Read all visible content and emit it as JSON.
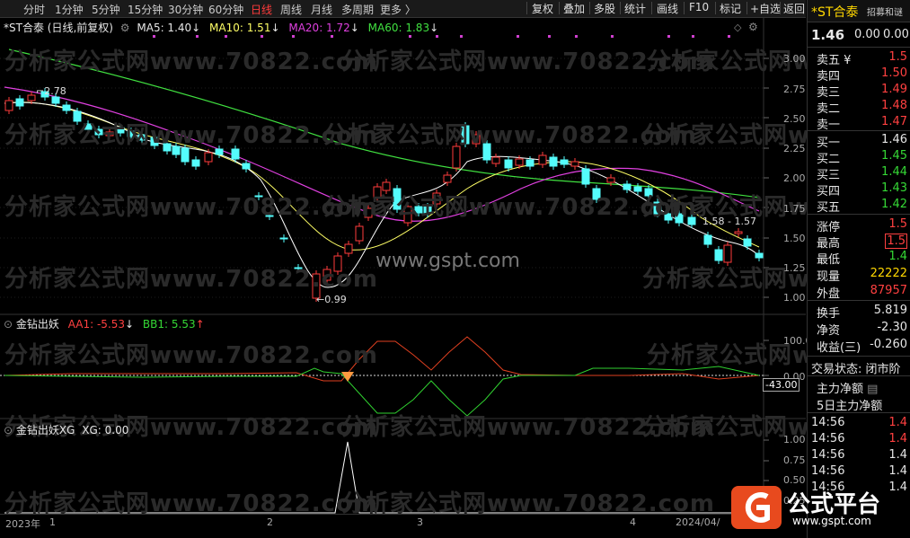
{
  "toolbar": {
    "periods": [
      "分时",
      "1分钟",
      "5分钟",
      "15分钟",
      "30分钟",
      "60分钟",
      "日线",
      "周线",
      "月线",
      "多周期",
      "更多 〉"
    ],
    "active_period": "日线",
    "buttons": [
      "复权",
      "叠加",
      "多股",
      "统计",
      "画线",
      "F10",
      "标记",
      "+自选",
      "返回"
    ]
  },
  "main": {
    "title": "*ST合泰 (日线,前复权)",
    "ma5": "MA5: 1.40",
    "ma10": "MA10: 1.51",
    "ma20": "MA20: 1.72",
    "ma60": "MA60: 1.83",
    "y_ticks": [
      "3.00",
      "2.75",
      "2.50",
      "2.25",
      "2.00",
      "1.75",
      "1.50",
      "1.25",
      "1.00"
    ],
    "high_label": "2.78",
    "low_label": "0.99",
    "range_label": "1.58 - 1.57",
    "watermark": "www.gspt.com",
    "wm_text": "分析家公式网www.70822.com"
  },
  "ind1": {
    "name": "金钻出妖",
    "aa1": "AA1: -5.53",
    "bb1": "BB1: 5.53",
    "y_ticks": [
      "100.0",
      "0.00"
    ],
    "value_tag": "-43.00"
  },
  "ind2": {
    "name": "金钻出妖XG",
    "xg": "XG: 0.00",
    "y_ticks": [
      "1.00",
      "0.75",
      "0.50",
      "0.25"
    ]
  },
  "xaxis": {
    "labels": [
      "2023年",
      "1",
      "2",
      "3",
      "4",
      "2024/04/"
    ]
  },
  "quote": {
    "name": "*ST合泰",
    "tag": "招募和谜",
    "price": "1.46",
    "change": "0.00",
    "pct": "0.00",
    "asks": [
      {
        "label": "卖五 ¥",
        "price": "1.5"
      },
      {
        "label": "卖四",
        "price": "1.50"
      },
      {
        "label": "卖三",
        "price": "1.49"
      },
      {
        "label": "卖二",
        "price": "1.48"
      },
      {
        "label": "卖一",
        "price": "1.47"
      }
    ],
    "bids": [
      {
        "label": "买一",
        "price": "1.46"
      },
      {
        "label": "买二",
        "price": "1.45"
      },
      {
        "label": "买三",
        "price": "1.44"
      },
      {
        "label": "买四",
        "price": "1.43"
      },
      {
        "label": "买五",
        "price": "1.42"
      }
    ],
    "stats": [
      {
        "label": "涨停",
        "value": "1.5"
      },
      {
        "label": "最高",
        "value": "1.5"
      },
      {
        "label": "最低",
        "value": "1.4"
      },
      {
        "label": "现量",
        "value": "22222"
      },
      {
        "label": "外盘",
        "value": "87957"
      }
    ],
    "stats2": [
      {
        "label": "换手",
        "value": "5.819"
      },
      {
        "label": "净资",
        "value": "-2.30"
      },
      {
        "label": "收益(三)",
        "value": "-0.260"
      }
    ],
    "trade_status": "交易状态: 闭市阶",
    "net_flow": "主力净额",
    "net_flow5": "5日主力净额",
    "ticks": [
      {
        "time": "14:56",
        "price": "1.4"
      },
      {
        "time": "14:56",
        "price": "1.4"
      },
      {
        "time": "14:56",
        "price": "1.4"
      },
      {
        "time": "14:56",
        "price": "1.4"
      },
      {
        "time": "14:56",
        "price": "1.4"
      }
    ]
  },
  "logo": {
    "name": "公式平台",
    "url": "www.gspt.com"
  }
}
